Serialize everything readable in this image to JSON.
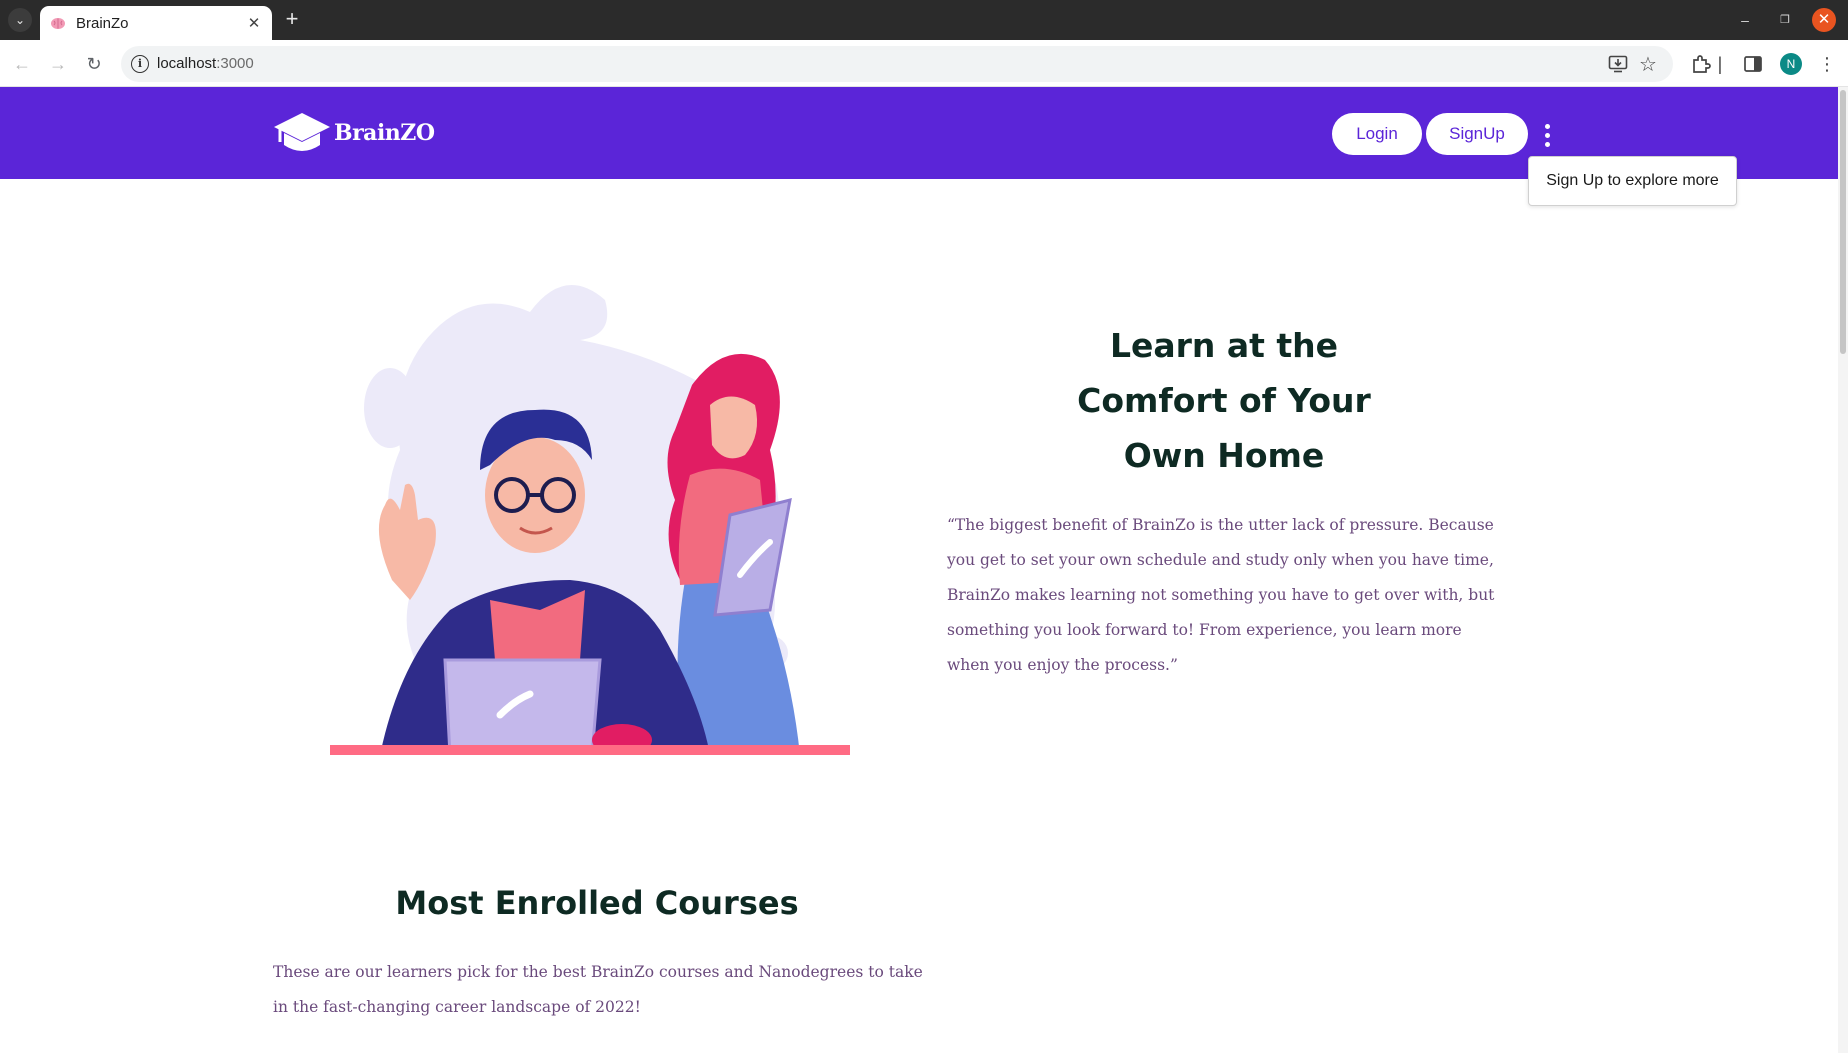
{
  "browser": {
    "tab_title": "BrainZo",
    "url_host": "localhost",
    "url_port": ":3000",
    "profile_initial": "N"
  },
  "navbar": {
    "logo_text": "BrainZO",
    "login_label": "Login",
    "signup_label": "SignUp",
    "more_tooltip": "Sign Up to explore more",
    "brand_color": "#5b25d8"
  },
  "hero": {
    "title_line1": "Learn at the",
    "title_line2": "Comfort of Your",
    "title_line3": "Own Home",
    "quote": "“The biggest benefit of BrainZo is the utter lack of pressure. Because you get to set your own schedule and study only when you have time, BrainZo makes learning not something you have to get over with, but something you look forward to! From experience, you learn more when you enjoy the process.”"
  },
  "courses": {
    "title": "Most Enrolled Courses",
    "description": "These are our learners pick for the best BrainZo courses and Nanodegrees to take in the fast-changing career landscape of 2022!"
  }
}
